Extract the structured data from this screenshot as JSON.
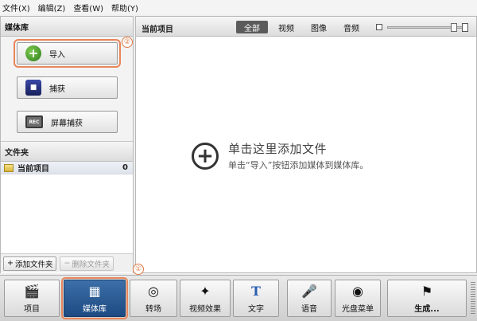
{
  "menu": [
    "文件(X)",
    "编辑(Z)",
    "查看(W)",
    "帮助(Y)"
  ],
  "library": {
    "title": "媒体库",
    "buttons": [
      {
        "label": "导入",
        "icon": "plus-circle-icon"
      },
      {
        "label": "捕获",
        "icon": "camcorder-icon"
      },
      {
        "label": "屏幕捕获",
        "icon": "screen-capture-icon"
      }
    ]
  },
  "folders": {
    "title": "文件夹",
    "items": [
      {
        "label": "当前项目",
        "count": "0"
      }
    ],
    "add_label": "添加文件夹",
    "delete_label": "删除文件夹"
  },
  "content": {
    "title": "当前项目",
    "tabs": [
      "全部",
      "视频",
      "图像",
      "音频"
    ],
    "active_tab": "全部",
    "slider_value": 1.0,
    "drop_title": "单击这里添加文件",
    "drop_hint": "单击“导入”按钮添加媒体到媒体库。"
  },
  "toolbar": [
    {
      "label": "项目",
      "icon": "clapperboard-icon"
    },
    {
      "label": "媒体库",
      "icon": "media-library-icon",
      "active": true
    },
    {
      "label": "转场",
      "icon": "transition-icon"
    },
    {
      "label": "视频效果",
      "icon": "video-effects-icon"
    },
    {
      "label": "文字",
      "icon": "text-icon"
    },
    {
      "label": "语音",
      "icon": "microphone-icon"
    },
    {
      "label": "光盘菜单",
      "icon": "disc-menu-icon"
    },
    {
      "label": "生成...",
      "icon": "produce-icon"
    }
  ],
  "markers": [
    "①",
    "②"
  ],
  "colors": {
    "accent_active": "#2a5a94",
    "highlight": "#e9855a"
  }
}
